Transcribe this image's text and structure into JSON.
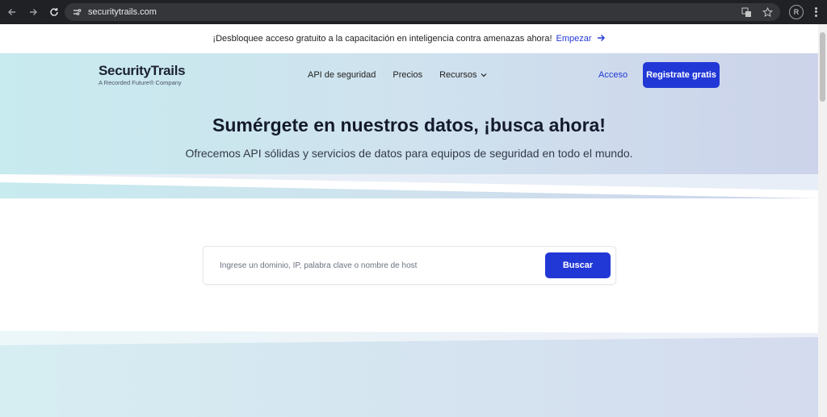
{
  "browser": {
    "url": "securitytrails.com",
    "profile_initial": "R",
    "icons": [
      "back-arrow-icon",
      "forward-arrow-icon",
      "reload-icon",
      "site-info-icon",
      "translate-icon",
      "star-icon",
      "kebab-menu-icon"
    ]
  },
  "announcement": {
    "text": "¡Desbloquee acceso gratuito a la capacitación en inteligencia contra amenazas ahora!",
    "link": "Empezar",
    "link_icon": "arrow-right-icon"
  },
  "header": {
    "logo_main": "SecurityTrails",
    "logo_sub": "A Recorded Future® Company",
    "nav": [
      "API de seguridad",
      "Precios",
      "Recursos"
    ],
    "nav_dropdown_icon": "chevron-down-icon",
    "login": "Acceso",
    "signup": "Registrate gratis"
  },
  "hero": {
    "title": "Sumérgete en nuestros datos, ¡busca ahora!",
    "subtitle": "Ofrecemos API sólidas y servicios de datos para equipos de seguridad en todo el mundo."
  },
  "search": {
    "placeholder": "Ingrese un dominio, IP, palabra clave o nombre de host",
    "value": "",
    "button": "Buscar"
  },
  "colors": {
    "accent": "#2238d6",
    "chrome_bg": "#202124",
    "hero_left": "#c7ebef",
    "hero_right": "#ccd3ea"
  }
}
